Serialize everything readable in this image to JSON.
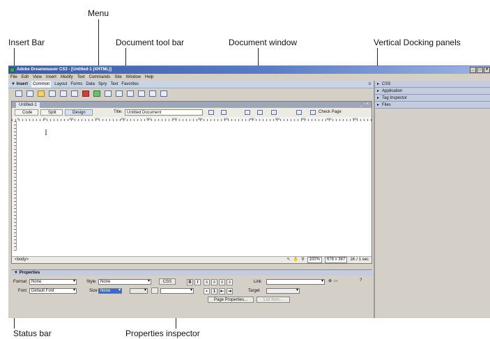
{
  "annotations": {
    "menu": "Menu",
    "insert_bar": "Insert Bar",
    "document_toolbar": "Document tool bar",
    "document_window": "Document window",
    "docking_panels": "Vertical Docking panels",
    "status_bar": "Status bar",
    "properties_inspector": "Properties inspector"
  },
  "window": {
    "title": "Adobe Dreamweaver CS3 - [Untitled-1 (XHTML)]",
    "controls": [
      "_",
      "□",
      "×"
    ]
  },
  "menu": [
    "File",
    "Edit",
    "View",
    "Insert",
    "Modify",
    "Text",
    "Commands",
    "Site",
    "Window",
    "Help"
  ],
  "insert_bar": {
    "label": "▼ Insert",
    "tabs": [
      "Common",
      "Layout",
      "Forms",
      "Data",
      "Spry",
      "Text",
      "Favorites"
    ],
    "active_tab": "Common",
    "options_icon": "options-menu-icon"
  },
  "document": {
    "tab_label": "Untitled-1",
    "window_controls": "_ ▫ ×",
    "view_buttons": [
      "Code",
      "Split",
      "Design"
    ],
    "title_label": "Title:",
    "title_value": "Untitled Document",
    "check_page": "Check Page",
    "ruler_marks": [
      "0",
      "50",
      "100",
      "150",
      "200",
      "250",
      "300",
      "350",
      "400",
      "450",
      "500",
      "550",
      "600",
      "650"
    ],
    "cursor": "I"
  },
  "status": {
    "tag_selector": "<body>",
    "zoom": "100%",
    "dimensions": "676 x 367",
    "size_time": "1K / 1 sec"
  },
  "properties": {
    "header": "▼ Properties",
    "format_label": "Format",
    "format_value": "None",
    "style_label": "Style",
    "style_value": "None",
    "css_button": "CSS",
    "font_label": "Font",
    "font_value": "Default Font",
    "size_label": "Size",
    "size_value": "None",
    "link_label": "Link",
    "target_label": "Target",
    "bold": "B",
    "italic": "I",
    "page_properties": "Page Properties...",
    "list_item": "List Item..."
  },
  "panels": [
    "CSS",
    "Application",
    "Tag Inspector",
    "Files"
  ]
}
